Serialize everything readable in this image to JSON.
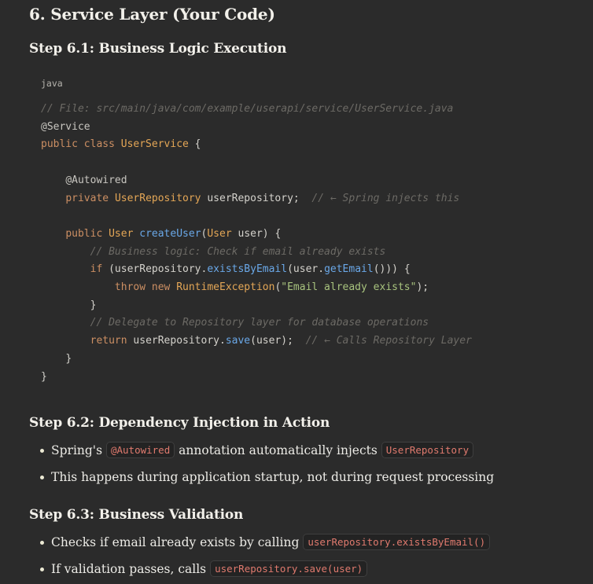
{
  "heading_main": "6. Service Layer (Your Code)",
  "step_6_1": {
    "title": "Step 6.1: Business Logic Execution",
    "language": "java",
    "code": {
      "l1": "// File: src/main/java/com/example/userapi/service/UserService.java",
      "l2_annot": "@Service",
      "l3_kw": "public class ",
      "l3_type": "UserService",
      "l3_rest": " {",
      "l5_annot": "@Autowired",
      "l6_kw": "private ",
      "l6_type": "UserRepository",
      "l6_rest": " userRepository;  ",
      "l6_comment": "// ← Spring injects this",
      "l8_kw": "public ",
      "l8_type": "User",
      "l8_fn": "createUser",
      "l8_p1": "(",
      "l8_ptype": "User",
      "l8_rest": " user) {",
      "l9_comment": "// Business logic: Check if email already exists",
      "l10_kw": "if",
      "l10_a": " (userRepository.",
      "l10_fn1": "existsByEmail",
      "l10_b": "(user.",
      "l10_fn2": "getEmail",
      "l10_c": "())) {",
      "l11_kw1": "throw",
      "l11_kw2": " new ",
      "l11_type": "RuntimeException",
      "l11_a": "(",
      "l11_str": "\"Email already exists\"",
      "l11_b": ");",
      "l12": "}",
      "l13_comment": "// Delegate to Repository layer for database operations",
      "l14_kw": "return",
      "l14_a": " userRepository.",
      "l14_fn": "save",
      "l14_b": "(user);  ",
      "l14_comment": "// ← Calls Repository Layer",
      "l15": "}",
      "l16": "}"
    }
  },
  "step_6_2": {
    "title": "Step 6.2: Dependency Injection in Action",
    "bullet1_a": "Spring's ",
    "bullet1_code1": "@Autowired",
    "bullet1_b": " annotation automatically injects ",
    "bullet1_code2": "UserRepository",
    "bullet2": "This happens during application startup, not during request processing"
  },
  "step_6_3": {
    "title": "Step 6.3: Business Validation",
    "bullet1_a": "Checks if email already exists by calling ",
    "bullet1_code": "userRepository.existsByEmail()",
    "bullet2_a": "If validation passes, calls ",
    "bullet2_code": "userRepository.save(user)"
  }
}
